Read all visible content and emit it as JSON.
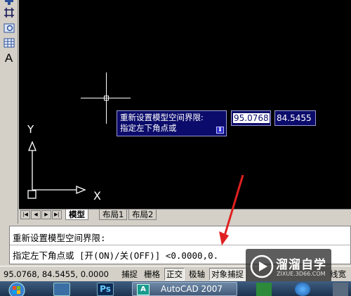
{
  "toolbar": {
    "icons": [
      "move-icon",
      "trim-icon",
      "region-icon",
      "table-icon",
      "text-icon"
    ],
    "text_tool_label": "A"
  },
  "drawing": {
    "background": "#000000",
    "ucs_x": "X",
    "ucs_y": "Y",
    "prompt_line1": "重新设置模型空间界限:",
    "prompt_line2": "指定左下角点或",
    "prompt_arrow": "⬇",
    "input_x": "95.0768",
    "input_y": "84.5455"
  },
  "tabs": {
    "items": [
      "模型",
      "布局1",
      "布局2"
    ],
    "active": "模型"
  },
  "command": {
    "line1": "重新设置模型空间界限:",
    "line2": "指定左下角点或 [开(ON)/关(OFF)] <0.0000,0."
  },
  "status": {
    "coords": "95.0768,  84.5455, 0.0000",
    "buttons": [
      "捕捉",
      "栅格",
      "正交",
      "极轴",
      "对象捕捉",
      "线宽"
    ],
    "pressed": [
      "正交",
      "对象捕捉"
    ]
  },
  "watermark": {
    "title": "溜溜自学",
    "subtitle": "ZIXUE.3D66.COM"
  },
  "taskbar": {
    "active_task": "AutoCAD 2007",
    "ps_label": "Ps",
    "acad_icon_label": "A"
  },
  "colors": {
    "prompt_bg": "#0b0b6b",
    "annotation_arrow": "#e02020",
    "chrome": "#d4d0c8"
  }
}
